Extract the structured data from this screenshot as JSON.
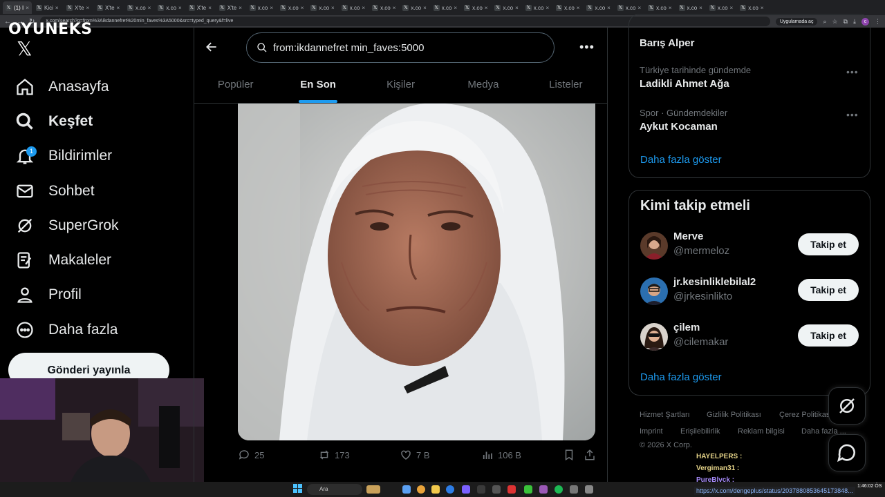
{
  "browser": {
    "tabs": [
      {
        "label": "(1) I",
        "active": true
      },
      {
        "label": "Kici"
      },
      {
        "label": "X'te"
      },
      {
        "label": "X'te"
      },
      {
        "label": "x.co"
      },
      {
        "label": "x.co"
      },
      {
        "label": "X'te"
      },
      {
        "label": "X'te"
      },
      {
        "label": "x.co"
      },
      {
        "label": "x.co"
      },
      {
        "label": "x.co"
      },
      {
        "label": "x.co"
      },
      {
        "label": "x.co"
      },
      {
        "label": "x.co"
      },
      {
        "label": "x.co"
      },
      {
        "label": "x.co"
      },
      {
        "label": "x.co"
      },
      {
        "label": "x.co"
      },
      {
        "label": "x.co"
      },
      {
        "label": "x.co"
      },
      {
        "label": "x.co"
      },
      {
        "label": "x.co"
      },
      {
        "label": "x.co"
      },
      {
        "label": "x.co"
      },
      {
        "label": "x.co"
      }
    ],
    "url": "x.com/search?q=from%3Aikdannefret%20min_faves%3A5000&src=typed_query&f=live",
    "open_in_app": "Uygulamada aç",
    "profile_initial": "c"
  },
  "brand": "OYUNEKS",
  "x_logo": "𝕏",
  "nav": [
    {
      "label": "Anasayfa",
      "icon": "home-icon"
    },
    {
      "label": "Keşfet",
      "icon": "search-icon"
    },
    {
      "label": "Bildirimler",
      "icon": "bell-icon",
      "badge": "1"
    },
    {
      "label": "Sohbet",
      "icon": "mail-icon"
    },
    {
      "label": "SuperGrok",
      "icon": "grok-icon"
    },
    {
      "label": "Makaleler",
      "icon": "article-icon"
    },
    {
      "label": "Profil",
      "icon": "person-icon"
    },
    {
      "label": "Daha fazla",
      "icon": "more-circle-icon"
    }
  ],
  "post_button": "Gönderi yayınla",
  "search": {
    "query": "from:ikdannefret min_faves:5000"
  },
  "tabs": [
    {
      "label": "Popüler"
    },
    {
      "label": "En Son",
      "active": true
    },
    {
      "label": "Kişiler"
    },
    {
      "label": "Medya"
    },
    {
      "label": "Listeler"
    }
  ],
  "tweet": {
    "replies": "25",
    "reposts": "173",
    "likes": "7 B",
    "views": "106 B"
  },
  "trends": [
    {
      "meta": "",
      "title": "Barış Alper"
    },
    {
      "meta": "Türkiye tarihinde gündemde",
      "title": "Ladikli Ahmet Ağa"
    },
    {
      "meta": "Spor · Gündemdekiler",
      "title": "Aykut Kocaman"
    }
  ],
  "show_more": "Daha fazla göster",
  "who_to_follow": {
    "title": "Kimi takip etmeli",
    "users": [
      {
        "name": "Merve",
        "handle": "@mermeloz",
        "button": "Takip et"
      },
      {
        "name": "jr.kesinliklebilal2",
        "handle": "@jrkesinlikto",
        "button": "Takip et"
      },
      {
        "name": "çilem",
        "handle": "@cilemakar",
        "button": "Takip et"
      }
    ],
    "show_more": "Daha fazla göster"
  },
  "footer": {
    "links_row1": [
      "Hizmet Şartları",
      "Gizlilik Politikası",
      "Çerez Politikası"
    ],
    "links_row2": [
      "Imprint",
      "Erişilebilirlik",
      "Reklam bilgisi",
      "Daha fazla ..."
    ],
    "copyright": "© 2026 X Corp."
  },
  "chat": [
    {
      "user": "HAYELPERS :"
    },
    {
      "user": "Vergiman31 :"
    },
    {
      "user": "PureBlvck :"
    }
  ],
  "status_url": "https://x.com/dengeplus/status/2037880853645173848...",
  "taskbar": {
    "search_placeholder": "Ara",
    "time": "1:46:02 ÖS",
    "date": "..."
  }
}
